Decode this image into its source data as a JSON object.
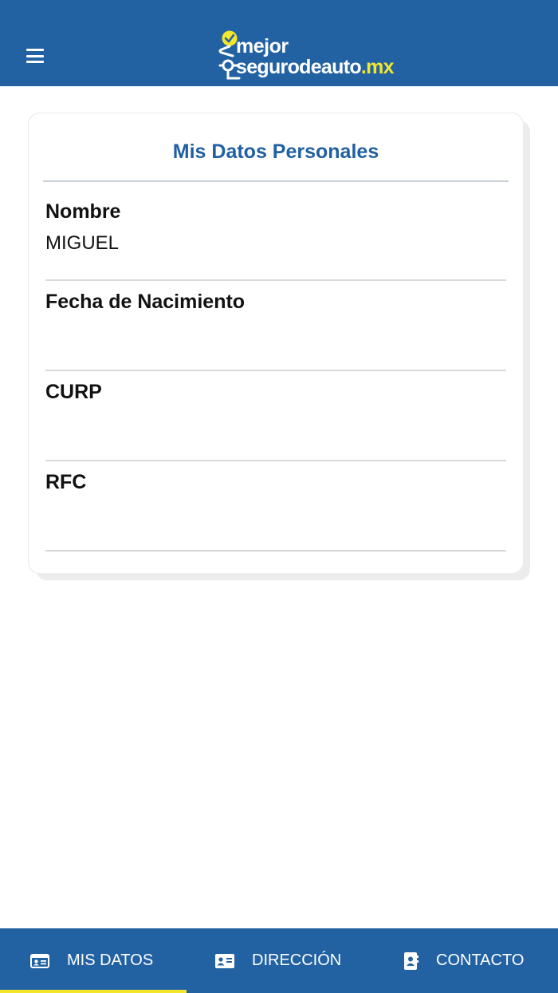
{
  "header": {
    "menu_icon": "hamburger-menu-icon",
    "logo": {
      "line1": "mejor",
      "line2": "segurodeauto",
      "tld": ".mx",
      "icon": "checkmark-road-icon"
    }
  },
  "card": {
    "title": "Mis Datos Personales",
    "fields": [
      {
        "label": "Nombre",
        "value": "MIGUEL"
      },
      {
        "label": "Fecha de Nacimiento",
        "value": ""
      },
      {
        "label": "CURP",
        "value": ""
      },
      {
        "label": "RFC",
        "value": ""
      }
    ]
  },
  "tabs": [
    {
      "label": "MIS DATOS",
      "icon": "id-card-icon",
      "active": true
    },
    {
      "label": "DIRECCIÓN",
      "icon": "address-card-icon",
      "active": false
    },
    {
      "label": "CONTACTO",
      "icon": "contact-book-icon",
      "active": false
    }
  ],
  "colors": {
    "primary": "#2262a3",
    "accent": "#f3e62b",
    "title": "#1f5fa3"
  }
}
